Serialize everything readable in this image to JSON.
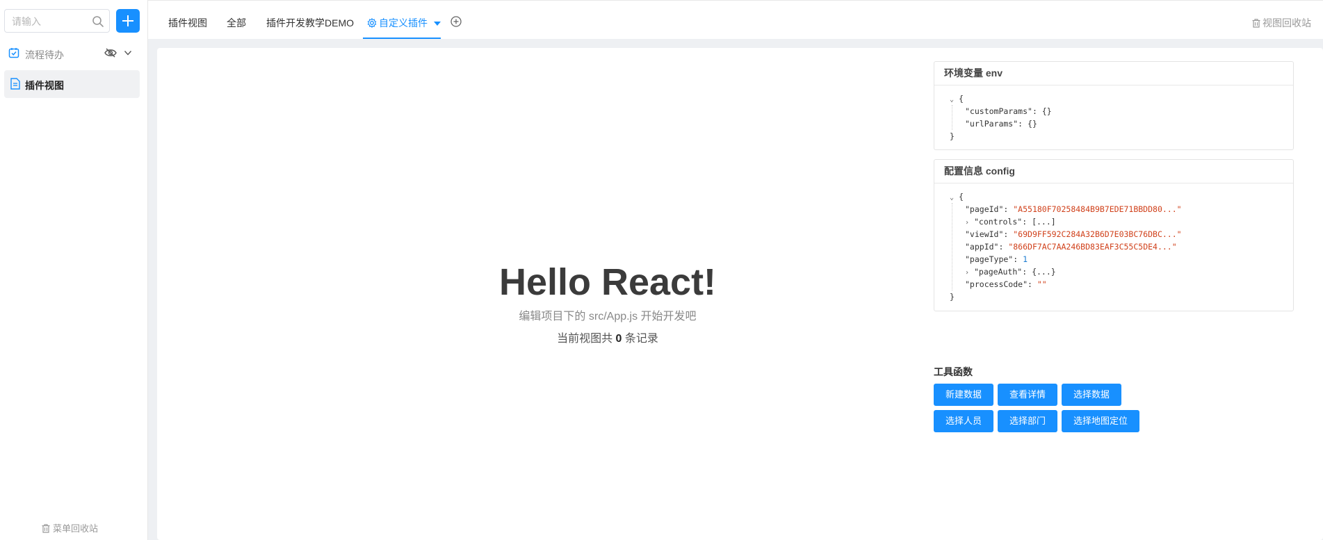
{
  "sidebar": {
    "search_placeholder": "请输入",
    "group_label": "流程待办",
    "items": [
      {
        "label": "插件视图"
      }
    ],
    "menu_bin": "菜单回收站"
  },
  "topbar": {
    "tabs": [
      {
        "label": "插件视图"
      },
      {
        "label": "全部"
      },
      {
        "label": "插件开发教学DEMO"
      },
      {
        "label": "自定义插件",
        "active": true
      }
    ],
    "view_bin": "视图回收站"
  },
  "main": {
    "title": "Hello React!",
    "subtitle": "编辑项目下的 src/App.js 开始开发吧",
    "count_prefix": "当前视图共",
    "count": "0",
    "count_suffix": "条记录"
  },
  "env_panel": {
    "title": "环境变量 env",
    "open": "{",
    "close": "}",
    "lines": [
      {
        "key": "\"customParams\"",
        "sep": ": ",
        "value": "{}"
      },
      {
        "key": "\"urlParams\"",
        "sep": ": ",
        "value": "{}"
      }
    ]
  },
  "config_panel": {
    "title": "配置信息 config",
    "open": "{",
    "close": "}",
    "lines": [
      {
        "key": "\"pageId\"",
        "sep": ": ",
        "value": "\"A55180F70258484B9B7EDE71BBDD80...\"",
        "kind": "str"
      },
      {
        "key": "\"controls\"",
        "sep": ": ",
        "value": "[...]",
        "kind": "col",
        "caret": "›"
      },
      {
        "key": "\"viewId\"",
        "sep": ": ",
        "value": "\"69D9FF592C284A32B6D7E03BC76DBC...\"",
        "kind": "str"
      },
      {
        "key": "\"appId\"",
        "sep": ": ",
        "value": "\"866DF7AC7AA246BD83EAF3C55C5DE4...\"",
        "kind": "str"
      },
      {
        "key": "\"pageType\"",
        "sep": ": ",
        "value": "1",
        "kind": "num"
      },
      {
        "key": "\"pageAuth\"",
        "sep": ": ",
        "value": "{...}",
        "kind": "col",
        "caret": "›"
      },
      {
        "key": "\"processCode\"",
        "sep": ": ",
        "value": "\"\"",
        "kind": "str"
      }
    ]
  },
  "tools": {
    "title": "工具函数",
    "buttons": [
      "新建数据",
      "查看详情",
      "选择数据",
      "选择人员",
      "选择部门",
      "选择地图定位"
    ]
  },
  "colors": {
    "accent": "#1890ff",
    "json_string": "#d0401a",
    "json_number": "#1a7ad0"
  },
  "icons": [
    "search-icon",
    "plus-icon",
    "checklist-icon",
    "eye-off-icon",
    "chevron-down-icon",
    "document-icon",
    "trash-icon",
    "gear-icon",
    "caret-down-icon",
    "add-circle-icon"
  ]
}
